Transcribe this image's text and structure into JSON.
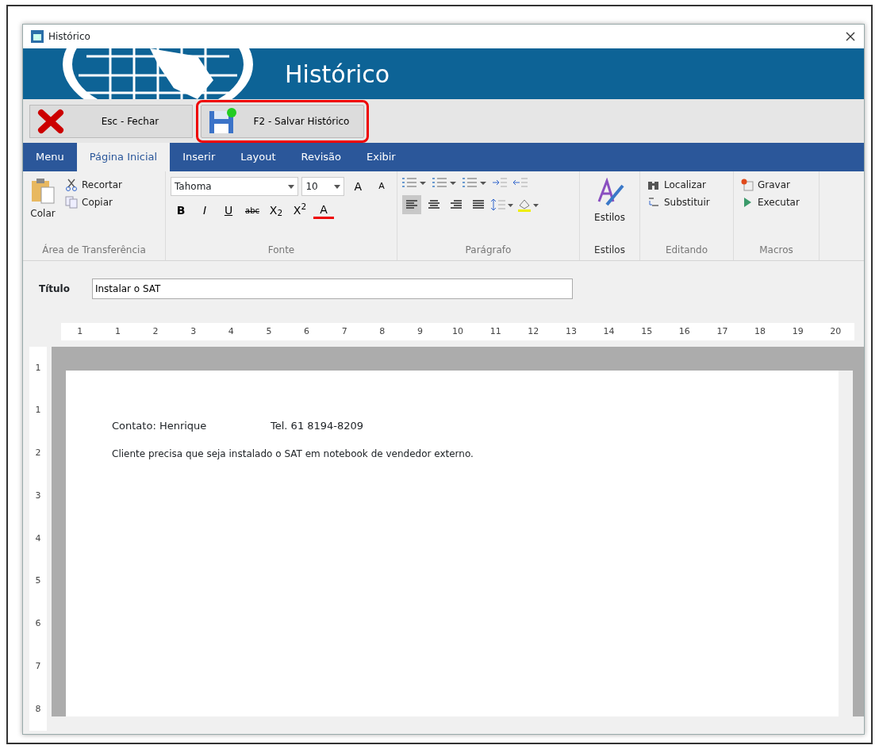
{
  "window": {
    "title": "Histórico"
  },
  "banner": {
    "title": "Histórico"
  },
  "actions": [
    {
      "label": "Esc - Fechar",
      "kind": "close",
      "highlighted": false
    },
    {
      "label": "F2 - Salvar Histórico",
      "kind": "save",
      "highlighted": true
    }
  ],
  "tabs": [
    {
      "label": "Menu",
      "selected": false
    },
    {
      "label": "Página Inicial",
      "selected": true
    },
    {
      "label": "Inserir",
      "selected": false
    },
    {
      "label": "Layout",
      "selected": false
    },
    {
      "label": "Revisão",
      "selected": false
    },
    {
      "label": "Exibir",
      "selected": false
    }
  ],
  "ribbon": {
    "clipboard": {
      "paste": "Colar",
      "cut": "Recortar",
      "copy": "Copiar",
      "label": "Área de Transferência"
    },
    "font": {
      "family": "Tahoma",
      "size": "10",
      "grow": "A",
      "shrink": "A",
      "bold": "B",
      "italic": "I",
      "underline": "U",
      "strike": "abc",
      "subscript": "X$_{2}$",
      "superscript": "X$^{2}$",
      "font_color_button": "A",
      "label": "Fonte"
    },
    "paragraph": {
      "align": [
        {
          "kind": "left",
          "selected": true
        },
        {
          "kind": "center",
          "selected": false
        },
        {
          "kind": "right",
          "selected": false
        },
        {
          "kind": "justify",
          "selected": false
        }
      ],
      "label": "Parágrafo"
    },
    "styles": {
      "button": "Estilos",
      "label": "Estilos"
    },
    "editing": {
      "find": "Localizar",
      "replace": "Substituir",
      "label": "Editando"
    },
    "macros": {
      "record": "Gravar",
      "run": "Executar",
      "label": "Macros"
    }
  },
  "title_field": {
    "label": "Título",
    "value": "Instalar o SAT"
  },
  "ruler": {
    "horizontal": [
      "1",
      "1",
      "2",
      "3",
      "4",
      "5",
      "6",
      "7",
      "8",
      "9",
      "10",
      "11",
      "12",
      "13",
      "14",
      "15",
      "16",
      "17",
      "18",
      "19",
      "20"
    ],
    "vertical": [
      "1",
      "1",
      "2",
      "3",
      "4",
      "5",
      "6",
      "7",
      "8"
    ]
  },
  "document": {
    "contact": "Contato: Henrique",
    "phone": "Tel. 61 8194-8209",
    "body": "Cliente precisa que seja instalado o SAT em notebook de vendedor externo."
  }
}
